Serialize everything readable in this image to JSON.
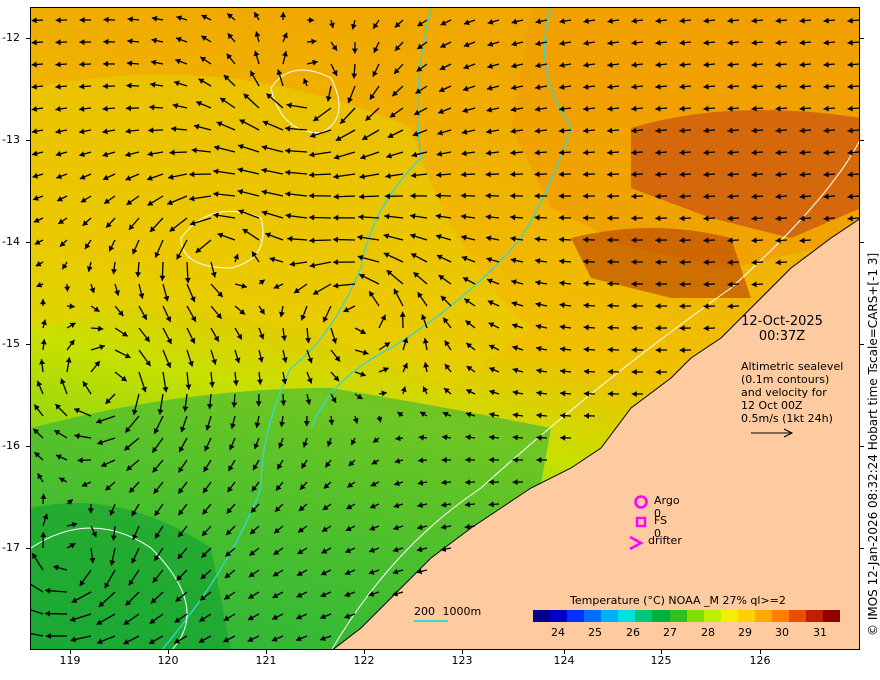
{
  "map": {
    "y_ticks": [
      "-12",
      "-13",
      "-14",
      "-15",
      "-16",
      "-17"
    ],
    "x_ticks": [
      "119",
      "120",
      "121",
      "122",
      "123",
      "124",
      "125",
      "126"
    ],
    "lon_range": [
      118.6,
      127.0
    ],
    "lat_range": [
      -17.95,
      -11.7
    ],
    "credit": "© IMOS 12-Jan-2026 08:32:24 Hobart time Tscale=CARS+[-1 3]",
    "date": "12-Oct-2025",
    "time": "00:37Z",
    "description": [
      "Altimetric sealevel",
      "(0.1m contours)",
      "and velocity for",
      "12 Oct 00Z",
      "0.5m/s (1kt 24h)"
    ],
    "legend": {
      "argo": "Argo 0",
      "fs": "FS 0",
      "drifter": "drifter"
    },
    "legend_colors": {
      "marker": "#ff00ff",
      "bathymetry": "#33d6d6",
      "land": "#fdcb9f",
      "contour": "#ffffff",
      "arrow": "#000000"
    },
    "colorbar": {
      "title": "Temperature (°C) NOAA _M 27% ql>=2",
      "labels": [
        "24",
        "25",
        "26",
        "27",
        "28",
        "29",
        "30",
        "31"
      ],
      "range": [
        23.5,
        31.5
      ],
      "colors": [
        "#00008f",
        "#0000c8",
        "#0030ff",
        "#0070ff",
        "#00b0ff",
        "#00e0e0",
        "#00c878",
        "#00b040",
        "#30c020",
        "#80e000",
        "#c0f000",
        "#f0f000",
        "#ffd000",
        "#ffa800",
        "#ff8000",
        "#e85000",
        "#c02000",
        "#900000"
      ]
    },
    "scale_bar": {
      "label_200": "200",
      "label_1000": "1000m"
    }
  }
}
